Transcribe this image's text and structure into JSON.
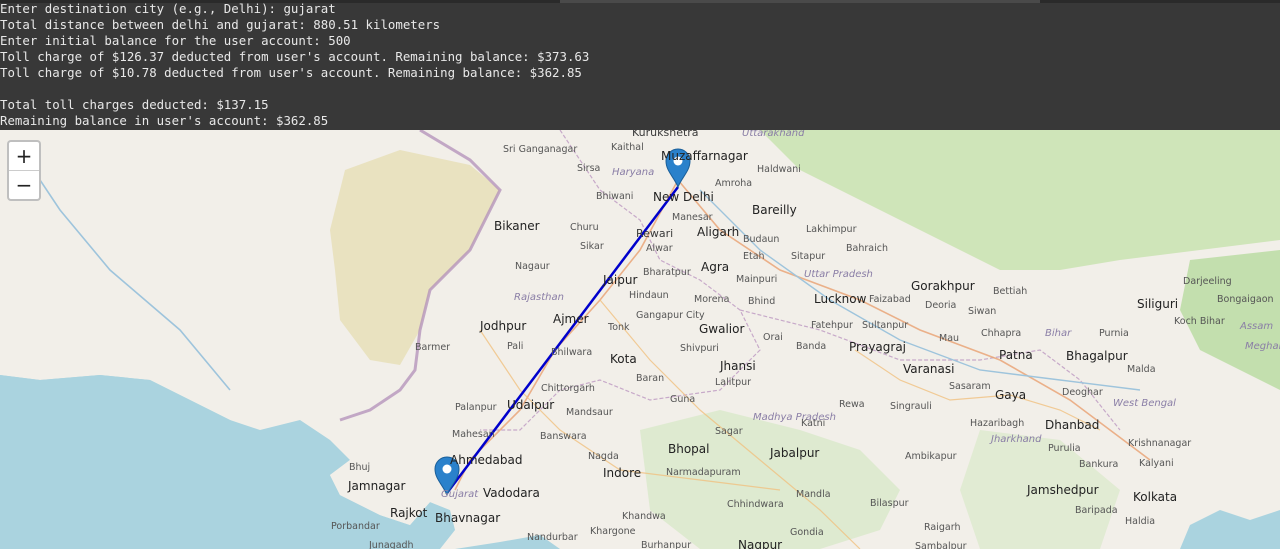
{
  "console": {
    "lines": [
      "Enter destination city (e.g., Delhi): gujarat",
      "Total distance between delhi and gujarat: 880.51 kilometers",
      "Enter initial balance for the user account: 500",
      "Toll charge of $126.37 deducted from user's account. Remaining balance: $373.63",
      "Toll charge of $10.78 deducted from user's account. Remaining balance: $362.85",
      "",
      "Total toll charges deducted: $137.15",
      "Remaining balance in user's account: $362.85"
    ]
  },
  "map": {
    "zoom_in": "+",
    "zoom_out": "−",
    "route_color": "#0000cc",
    "marker_color": "#2a81cb",
    "markers": [
      "New Delhi",
      "Gujarat"
    ],
    "labels": [
      "Kurukshetra",
      "Uttarakhand",
      "Muzaffarnagar",
      "Sri Ganganagar",
      "Kaithal",
      "Sirsa",
      "Haryana",
      "Bhiwani",
      "New Delhi",
      "Amroha",
      "Haldwani",
      "Manesar",
      "Bareilly",
      "Lakhimpur",
      "Bahraich",
      "Rewari",
      "Aligarh",
      "Budaun",
      "Bikaner",
      "Churu",
      "Sikar",
      "Alwar",
      "Etah",
      "Sitapur",
      "Uttar Pradesh",
      "Nagaur",
      "Jaipur",
      "Bharatpur",
      "Agra",
      "Mainpuri",
      "Lucknow",
      "Faizabad",
      "Gorakhpur",
      "Bettiah",
      "Siliguri",
      "Darjeeling",
      "Bongaigaon",
      "Hindaun",
      "Morena",
      "Bhind",
      "Deoria",
      "Rajasthan",
      "Jodhpur",
      "Ajmer",
      "Tonk",
      "Gangapur City",
      "Gwalior",
      "Fatehpur",
      "Sultanpur",
      "Siwan",
      "Chhapra",
      "Bihar",
      "Purnia",
      "Koch Bihar",
      "Assam",
      "Meghalaya",
      "Pali",
      "Barmer",
      "Orai",
      "Banda",
      "Prayagraj",
      "Mau",
      "Patna",
      "Bhagalpur",
      "Shivpuri",
      "Bhilwara",
      "Kota",
      "Jhansi",
      "Varanasi",
      "Malda",
      "Baran",
      "Lalitpur",
      "Sasaram",
      "Gaya",
      "Deoghar",
      "Chittorgarh",
      "Guna",
      "Rewa",
      "Singrauli",
      "Palanpur",
      "Udaipur",
      "Mandsaur",
      "Madhya Pradesh",
      "Katni",
      "West Bengal",
      "Sagar",
      "Hazaribagh",
      "Dhanbad",
      "Mahesan",
      "Banswara",
      "Jharkhand",
      "Purulia",
      "Krishnanagar",
      "Bhuj",
      "Ahmedabad",
      "Nagda",
      "Bhopal",
      "Jabalpur",
      "Ambikapur",
      "Bankura",
      "Kalyani",
      "Indore",
      "Narmadapuram",
      "Jamnagar",
      "Gujarat",
      "Vadodara",
      "Mandla",
      "Jamshedpur",
      "Kolkata",
      "Rajkot",
      "Bhavnagar",
      "Khandwa",
      "Chhindwara",
      "Bilaspur",
      "Baripada",
      "Porbandar",
      "Khargone",
      "Nandurbar",
      "Gondia",
      "Raigarh",
      "Haldia",
      "Junagadh",
      "Burhanpur",
      "Nagpur",
      "Sambalpur"
    ]
  }
}
